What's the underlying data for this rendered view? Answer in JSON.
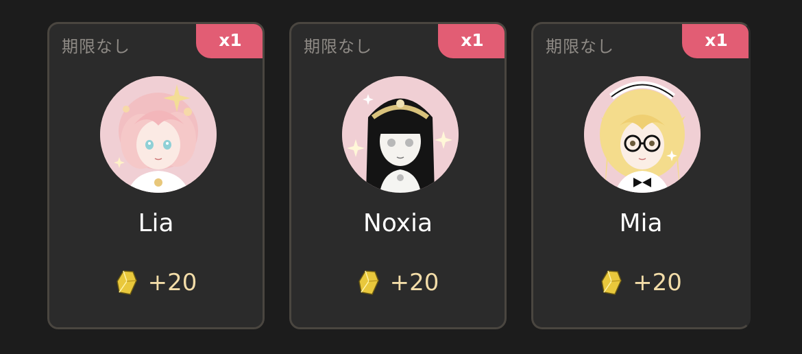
{
  "cards": [
    {
      "expiry": "期限なし",
      "qty": "x1",
      "name": "Lia",
      "reward": "+20",
      "icon": "crystal-icon",
      "avatar": "avatar-lia"
    },
    {
      "expiry": "期限なし",
      "qty": "x1",
      "name": "Noxia",
      "reward": "+20",
      "icon": "crystal-icon",
      "avatar": "avatar-noxia"
    },
    {
      "expiry": "期限なし",
      "qty": "x1",
      "name": "Mia",
      "reward": "+20",
      "icon": "crystal-icon",
      "avatar": "avatar-mia"
    }
  ],
  "colors": {
    "background": "#1c1c1c",
    "card": "#2b2b2b",
    "card_border": "#4a4640",
    "badge": "#e25d74",
    "reward_text": "#f2dca8",
    "avatar_bg": "#f0cfd4"
  }
}
